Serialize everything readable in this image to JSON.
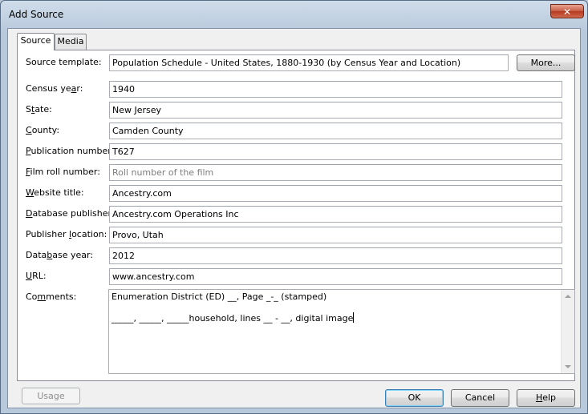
{
  "window": {
    "title": "Add Source",
    "close_glyph": "✕"
  },
  "tabs": [
    {
      "label": "Source",
      "active": true
    },
    {
      "label": "Media",
      "active": false
    }
  ],
  "source_template": {
    "label": "Source template:",
    "value": "Population Schedule - United States, 1880-1930 (by Census Year and Location)",
    "more_label": "More..."
  },
  "fields": {
    "census_year": {
      "label_pre": "Census ye",
      "label_u": "a",
      "label_post": "r:",
      "value": "1940"
    },
    "state": {
      "label_pre": "S",
      "label_u": "t",
      "label_post": "ate:",
      "value": "New Jersey"
    },
    "county": {
      "label_pre": "",
      "label_u": "C",
      "label_post": "ounty:",
      "value": "Camden County"
    },
    "publication_number": {
      "label_pre": "",
      "label_u": "P",
      "label_post": "ublication number:",
      "value": "T627"
    },
    "film_roll_number": {
      "label_pre": "",
      "label_u": "F",
      "label_post": "ilm roll number:",
      "placeholder": "Roll number of the film"
    },
    "website_title": {
      "label_pre": "",
      "label_u": "W",
      "label_post": "ebsite title:",
      "value": "Ancestry.com"
    },
    "database_publisher": {
      "label_pre": "",
      "label_u": "D",
      "label_post": "atabase publisher:",
      "value": "Ancestry.com Operations Inc"
    },
    "publisher_location": {
      "label_pre": "Publisher ",
      "label_u": "l",
      "label_post": "ocation:",
      "value": "Provo, Utah"
    },
    "database_year": {
      "label_pre": "Data",
      "label_u": "b",
      "label_post": "ase year:",
      "value": "2012"
    },
    "url": {
      "label_pre": "",
      "label_u": "U",
      "label_post": "RL:",
      "value": "www.ancestry.com"
    }
  },
  "comments": {
    "label_pre": "Co",
    "label_u": "m",
    "label_post": "ments:",
    "line1": "Enumeration District (ED) __, Page _-_ (stamped)",
    "line2": "_____, _____, _____household, lines __ - __, digital image"
  },
  "buttons": {
    "usage": "Usage",
    "ok": "OK",
    "cancel": "Cancel",
    "help_u": "H",
    "help_rest": "elp"
  }
}
